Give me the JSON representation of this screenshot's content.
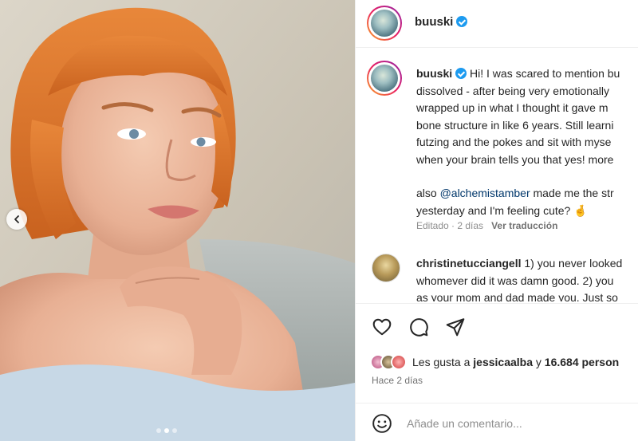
{
  "post": {
    "username": "buuski",
    "verified": true,
    "caption": {
      "username": "buuski",
      "lines": [
        "Hi! I was scared to mention bu",
        "dissolved - after being very emotionally",
        "wrapped up in what I thought it gave m",
        "bone structure in like 6 years. Still learni",
        "futzing and the pokes and sit with myse",
        "when your brain tells you that yes! more"
      ],
      "mention": "@alchemistamber",
      "line2_rest": " made me the str",
      "line3": "yesterday and I'm feeling cute? 🤞"
    },
    "meta": {
      "edited": "Editado · 2 días",
      "translate": "Ver traducción"
    },
    "comment": {
      "username": "christinetucciangell",
      "line1_rest": " 1) you never looked",
      "line2": "whomever did it was damn good. 2) you",
      "line3": "as your mom and dad made you. Just so"
    },
    "likes": {
      "prefix": "Les gusta a ",
      "user": "jessicaalba",
      "joiner": " y ",
      "count": "16.684 person"
    },
    "time_ago": "Hace 2 días",
    "comment_placeholder": "Añade un comentario...",
    "carousel": {
      "slides": 3,
      "active_index": 0
    }
  },
  "icons": {
    "like": "heart-icon",
    "comment": "comment-icon",
    "share": "send-icon",
    "emoji": "emoji-icon",
    "prev": "chevron-left-icon"
  },
  "colors": {
    "verified": "#1d9bf0",
    "mention": "#00376b",
    "hair": "#e07a2c",
    "muted": "#8e8e8e"
  }
}
